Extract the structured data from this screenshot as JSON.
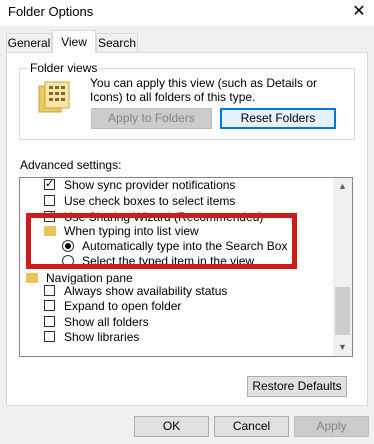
{
  "window": {
    "title": "Folder Options",
    "close_glyph": "✕"
  },
  "tabs": [
    {
      "label": "General"
    },
    {
      "label": "View"
    },
    {
      "label": "Search"
    }
  ],
  "folder_views": {
    "label": "Folder views",
    "description": "You can apply this view (such as Details or Icons) to all folders of this type.",
    "apply_label": "Apply to Folders",
    "reset_label": "Reset Folders"
  },
  "advanced": {
    "label": "Advanced settings:",
    "items": [
      {
        "type": "checkbox",
        "checked": true,
        "label": "Show sync provider notifications"
      },
      {
        "type": "checkbox",
        "checked": false,
        "label": "Use check boxes to select items"
      },
      {
        "type": "checkbox",
        "checked": true,
        "label": "Use Sharing Wizard (Recommended)"
      },
      {
        "type": "folder",
        "label": "When typing into list view"
      },
      {
        "type": "radio",
        "checked": true,
        "label": "Automatically type into the Search Box"
      },
      {
        "type": "radio",
        "checked": false,
        "label": "Select the typed item in the view"
      },
      {
        "type": "folder",
        "label": "Navigation pane"
      },
      {
        "type": "checkbox",
        "checked": false,
        "label": "Always show availability status"
      },
      {
        "type": "checkbox",
        "checked": false,
        "label": "Expand to open folder"
      },
      {
        "type": "checkbox",
        "checked": false,
        "label": "Show all folders"
      },
      {
        "type": "checkbox",
        "checked": false,
        "label": "Show libraries"
      }
    ]
  },
  "restore_defaults_label": "Restore Defaults",
  "footer": {
    "ok_label": "OK",
    "cancel_label": "Cancel",
    "apply_label": "Apply"
  }
}
